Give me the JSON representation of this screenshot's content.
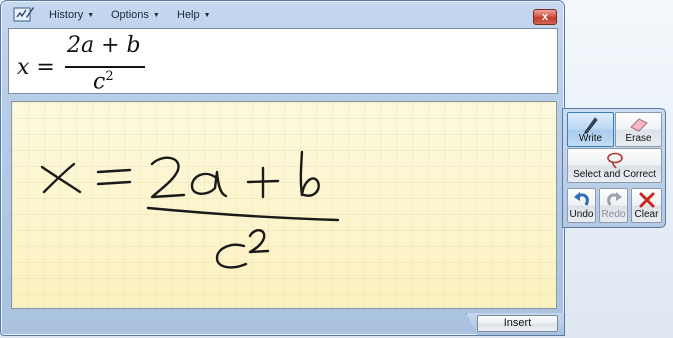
{
  "menu": {
    "history": "History",
    "options": "Options",
    "help": "Help"
  },
  "window": {
    "close_glyph": "x"
  },
  "preview": {
    "lhs": "x =",
    "numerator": "2a + b",
    "denominator_base": "c",
    "denominator_exp": "2"
  },
  "tools": {
    "write": "Write",
    "erase": "Erase",
    "select_correct": "Select and Correct",
    "undo": "Undo",
    "redo": "Redo",
    "clear": "Clear"
  },
  "insert_label": "Insert",
  "icons": [
    "app-pen-icon",
    "pen-icon",
    "eraser-icon",
    "lasso-icon",
    "undo-arrow-icon",
    "redo-arrow-icon",
    "clear-x-icon"
  ],
  "colors": {
    "pad": "#fcf6d2",
    "ink": "#1a1a1a",
    "accent": "#3c7fb1",
    "close": "#c23b2c"
  }
}
